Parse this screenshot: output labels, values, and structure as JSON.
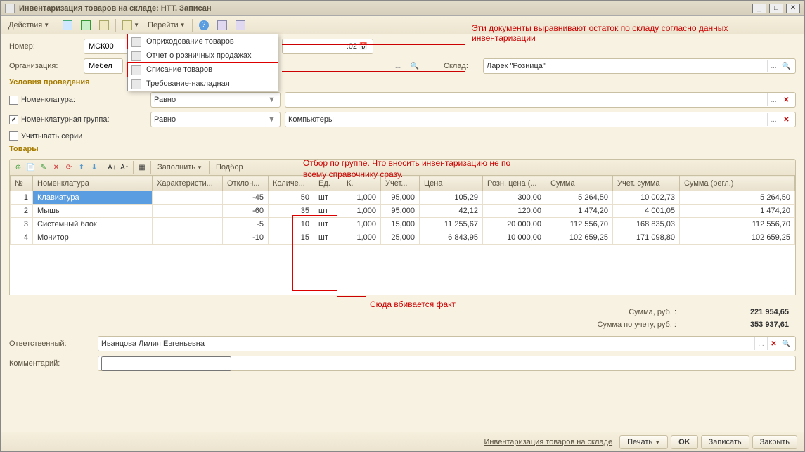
{
  "window": {
    "title": "Инвентаризация товаров на складе: НТТ. Записан"
  },
  "toolbar": {
    "actions": "Действия",
    "goto": "Перейти"
  },
  "menu": {
    "item1": "Оприходование товаров",
    "item2": "Отчет о розничных продажах",
    "item3": "Списание товаров",
    "item4": "Требование-накладная"
  },
  "form": {
    "number_label": "Номер:",
    "number_value": "МСК00",
    "date_suffix": ":02",
    "org_label": "Организация:",
    "org_value": "Мебел",
    "sklad_label": "Склад:",
    "sklad_value": "Ларек \"Розница\""
  },
  "conditions_title": "Условия проведения",
  "filters": {
    "nomen_label": "Номенклатура:",
    "nomen_op": "Равно",
    "group_label": "Номенклатурная группа:",
    "group_op": "Равно",
    "group_value": "Компьютеры",
    "series_label": "Учитывать серии"
  },
  "goods_title": "Товары",
  "table_toolbar": {
    "fill": "Заполнить",
    "select": "Подбор"
  },
  "table": {
    "headers": {
      "n": "№",
      "nom": "Номенклатура",
      "char": "Характеристи...",
      "dev": "Отклон...",
      "qty": "Количе...",
      "unit": "Ед.",
      "k": "К.",
      "acc": "Учет...",
      "price": "Цена",
      "retail": "Розн. цена (...",
      "sum": "Сумма",
      "acc_sum": "Учет. сумма",
      "regl": "Сумма (регл.)"
    },
    "rows": [
      {
        "n": "1",
        "nom": "Клавиатура",
        "dev": "-45",
        "qty": "50",
        "unit": "шт",
        "k": "1,000",
        "acc": "95,000",
        "price": "105,29",
        "retail": "300,00",
        "sum": "5 264,50",
        "acc_sum": "10 002,73",
        "regl": "5 264,50"
      },
      {
        "n": "2",
        "nom": "Мышь",
        "dev": "-60",
        "qty": "35",
        "unit": "шт",
        "k": "1,000",
        "acc": "95,000",
        "price": "42,12",
        "retail": "120,00",
        "sum": "1 474,20",
        "acc_sum": "4 001,05",
        "regl": "1 474,20"
      },
      {
        "n": "3",
        "nom": "Системный блок",
        "dev": "-5",
        "qty": "10",
        "unit": "шт",
        "k": "1,000",
        "acc": "15,000",
        "price": "11 255,67",
        "retail": "20 000,00",
        "sum": "112 556,70",
        "acc_sum": "168 835,03",
        "regl": "112 556,70"
      },
      {
        "n": "4",
        "nom": "Монитор",
        "dev": "-10",
        "qty": "15",
        "unit": "шт",
        "k": "1,000",
        "acc": "25,000",
        "price": "6 843,95",
        "retail": "10 000,00",
        "sum": "102 659,25",
        "acc_sum": "171 098,80",
        "regl": "102 659,25"
      }
    ]
  },
  "totals": {
    "sum_label": "Сумма, руб. :",
    "sum_value": "221 954,65",
    "acc_label": "Сумма по учету, руб. :",
    "acc_value": "353 937,61"
  },
  "footer": {
    "resp_label": "Ответственный:",
    "resp_value": "Иванцова Лилия Евгеньевна",
    "comment_label": "Комментарий:"
  },
  "bottom": {
    "link": "Инвентаризация товаров на складе",
    "print": "Печать",
    "ok": "OK",
    "save": "Записать",
    "close": "Закрыть"
  },
  "annotations": {
    "a1": "Эти документы выравнивают остаток по складу согласно данных инвентаризации",
    "a2a": "Отбор по группе. Что вносить инвентаризацию не по",
    "a2b": "всему справочнику сразу.",
    "a3": "Сюда вбивается факт"
  }
}
